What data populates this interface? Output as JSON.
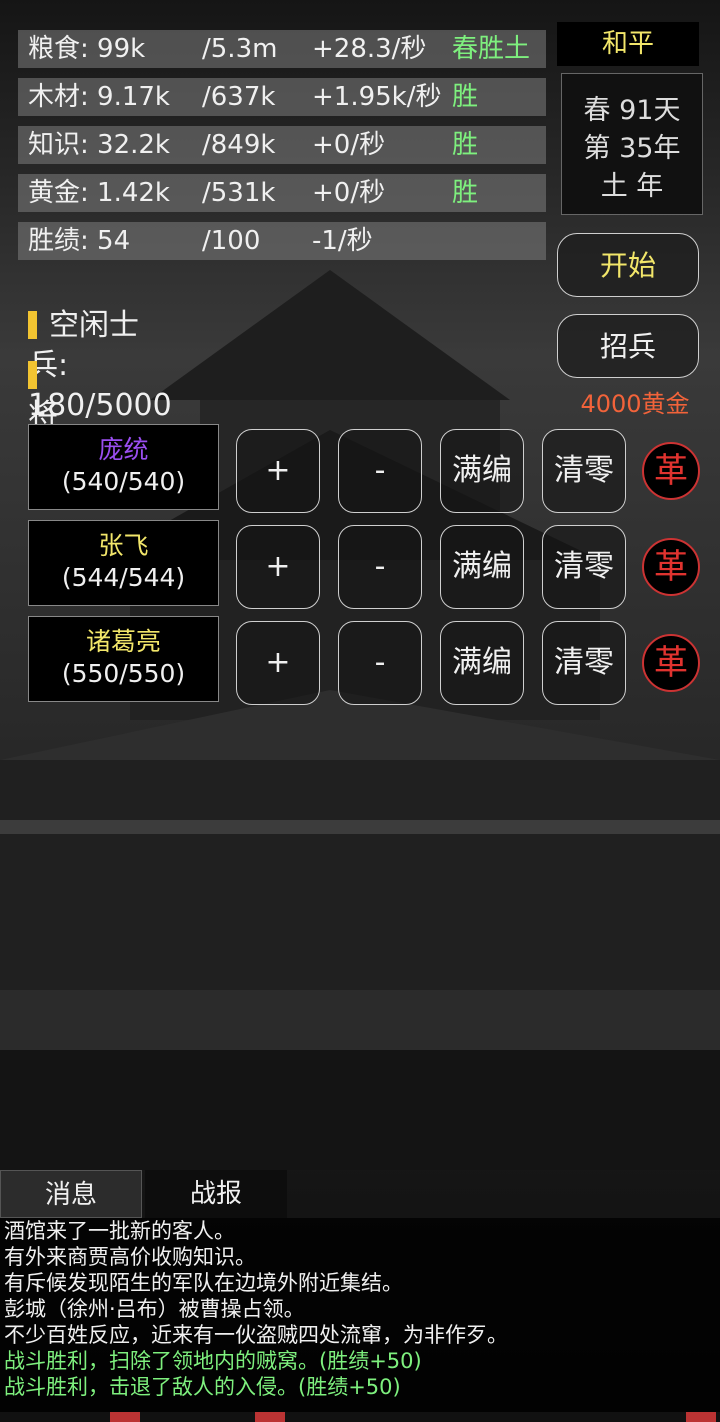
{
  "resources": [
    {
      "name_label": "粮食: 99k",
      "cap": "/5.3m",
      "rate": "+28.3/秒",
      "status": "春胜土"
    },
    {
      "name_label": "木材: 9.17k",
      "cap": "/637k",
      "rate": "+1.95k/秒",
      "status": "胜"
    },
    {
      "name_label": "知识: 32.2k",
      "cap": "/849k",
      "rate": "+0/秒",
      "status": "胜"
    },
    {
      "name_label": "黄金: 1.42k",
      "cap": "/531k",
      "rate": "+0/秒",
      "status": "胜"
    },
    {
      "name_label": "胜绩: 54",
      "cap": "/100",
      "rate": "-1/秒",
      "status": ""
    }
  ],
  "state_label": "和平",
  "date": {
    "line1": "春 91天",
    "line2": "第 35年",
    "line3": "土 年"
  },
  "start_label": "开始",
  "recruit": {
    "label": "招兵",
    "cost": "4000黄金"
  },
  "stats": {
    "idle_soldiers": "空闲士兵: 180/5000",
    "general_count": "将领数量: 3/5"
  },
  "generals": [
    {
      "name": "庞统",
      "troops": "(540/540)",
      "color": "#9a4ef0"
    },
    {
      "name": "张飞",
      "troops": "(544/544)",
      "color": "#f2e66a"
    },
    {
      "name": "诸葛亮",
      "troops": "(550/550)",
      "color": "#f2e66a"
    }
  ],
  "general_buttons": {
    "plus": "+",
    "minus": "-",
    "full": "满编",
    "clear": "清零",
    "dismiss": "革"
  },
  "tabs": {
    "messages": "消息",
    "battle": "战报"
  },
  "log": [
    {
      "text": "酒馆来了一批新的客人。",
      "type": "normal"
    },
    {
      "text": "有外来商贾高价收购知识。",
      "type": "normal"
    },
    {
      "text": "有斥候发现陌生的军队在边境外附近集结。",
      "type": "normal"
    },
    {
      "text": "彭城（徐州·吕布）被曹操占领。",
      "type": "normal"
    },
    {
      "text": "不少百姓反应，近来有一伙盗贼四处流窜，为非作歹。",
      "type": "normal"
    },
    {
      "text": "战斗胜利，扫除了领地内的贼窝。(胜绩+50)",
      "type": "win"
    },
    {
      "text": "战斗胜利，击退了敌人的入侵。(胜绩+50)",
      "type": "win"
    }
  ]
}
